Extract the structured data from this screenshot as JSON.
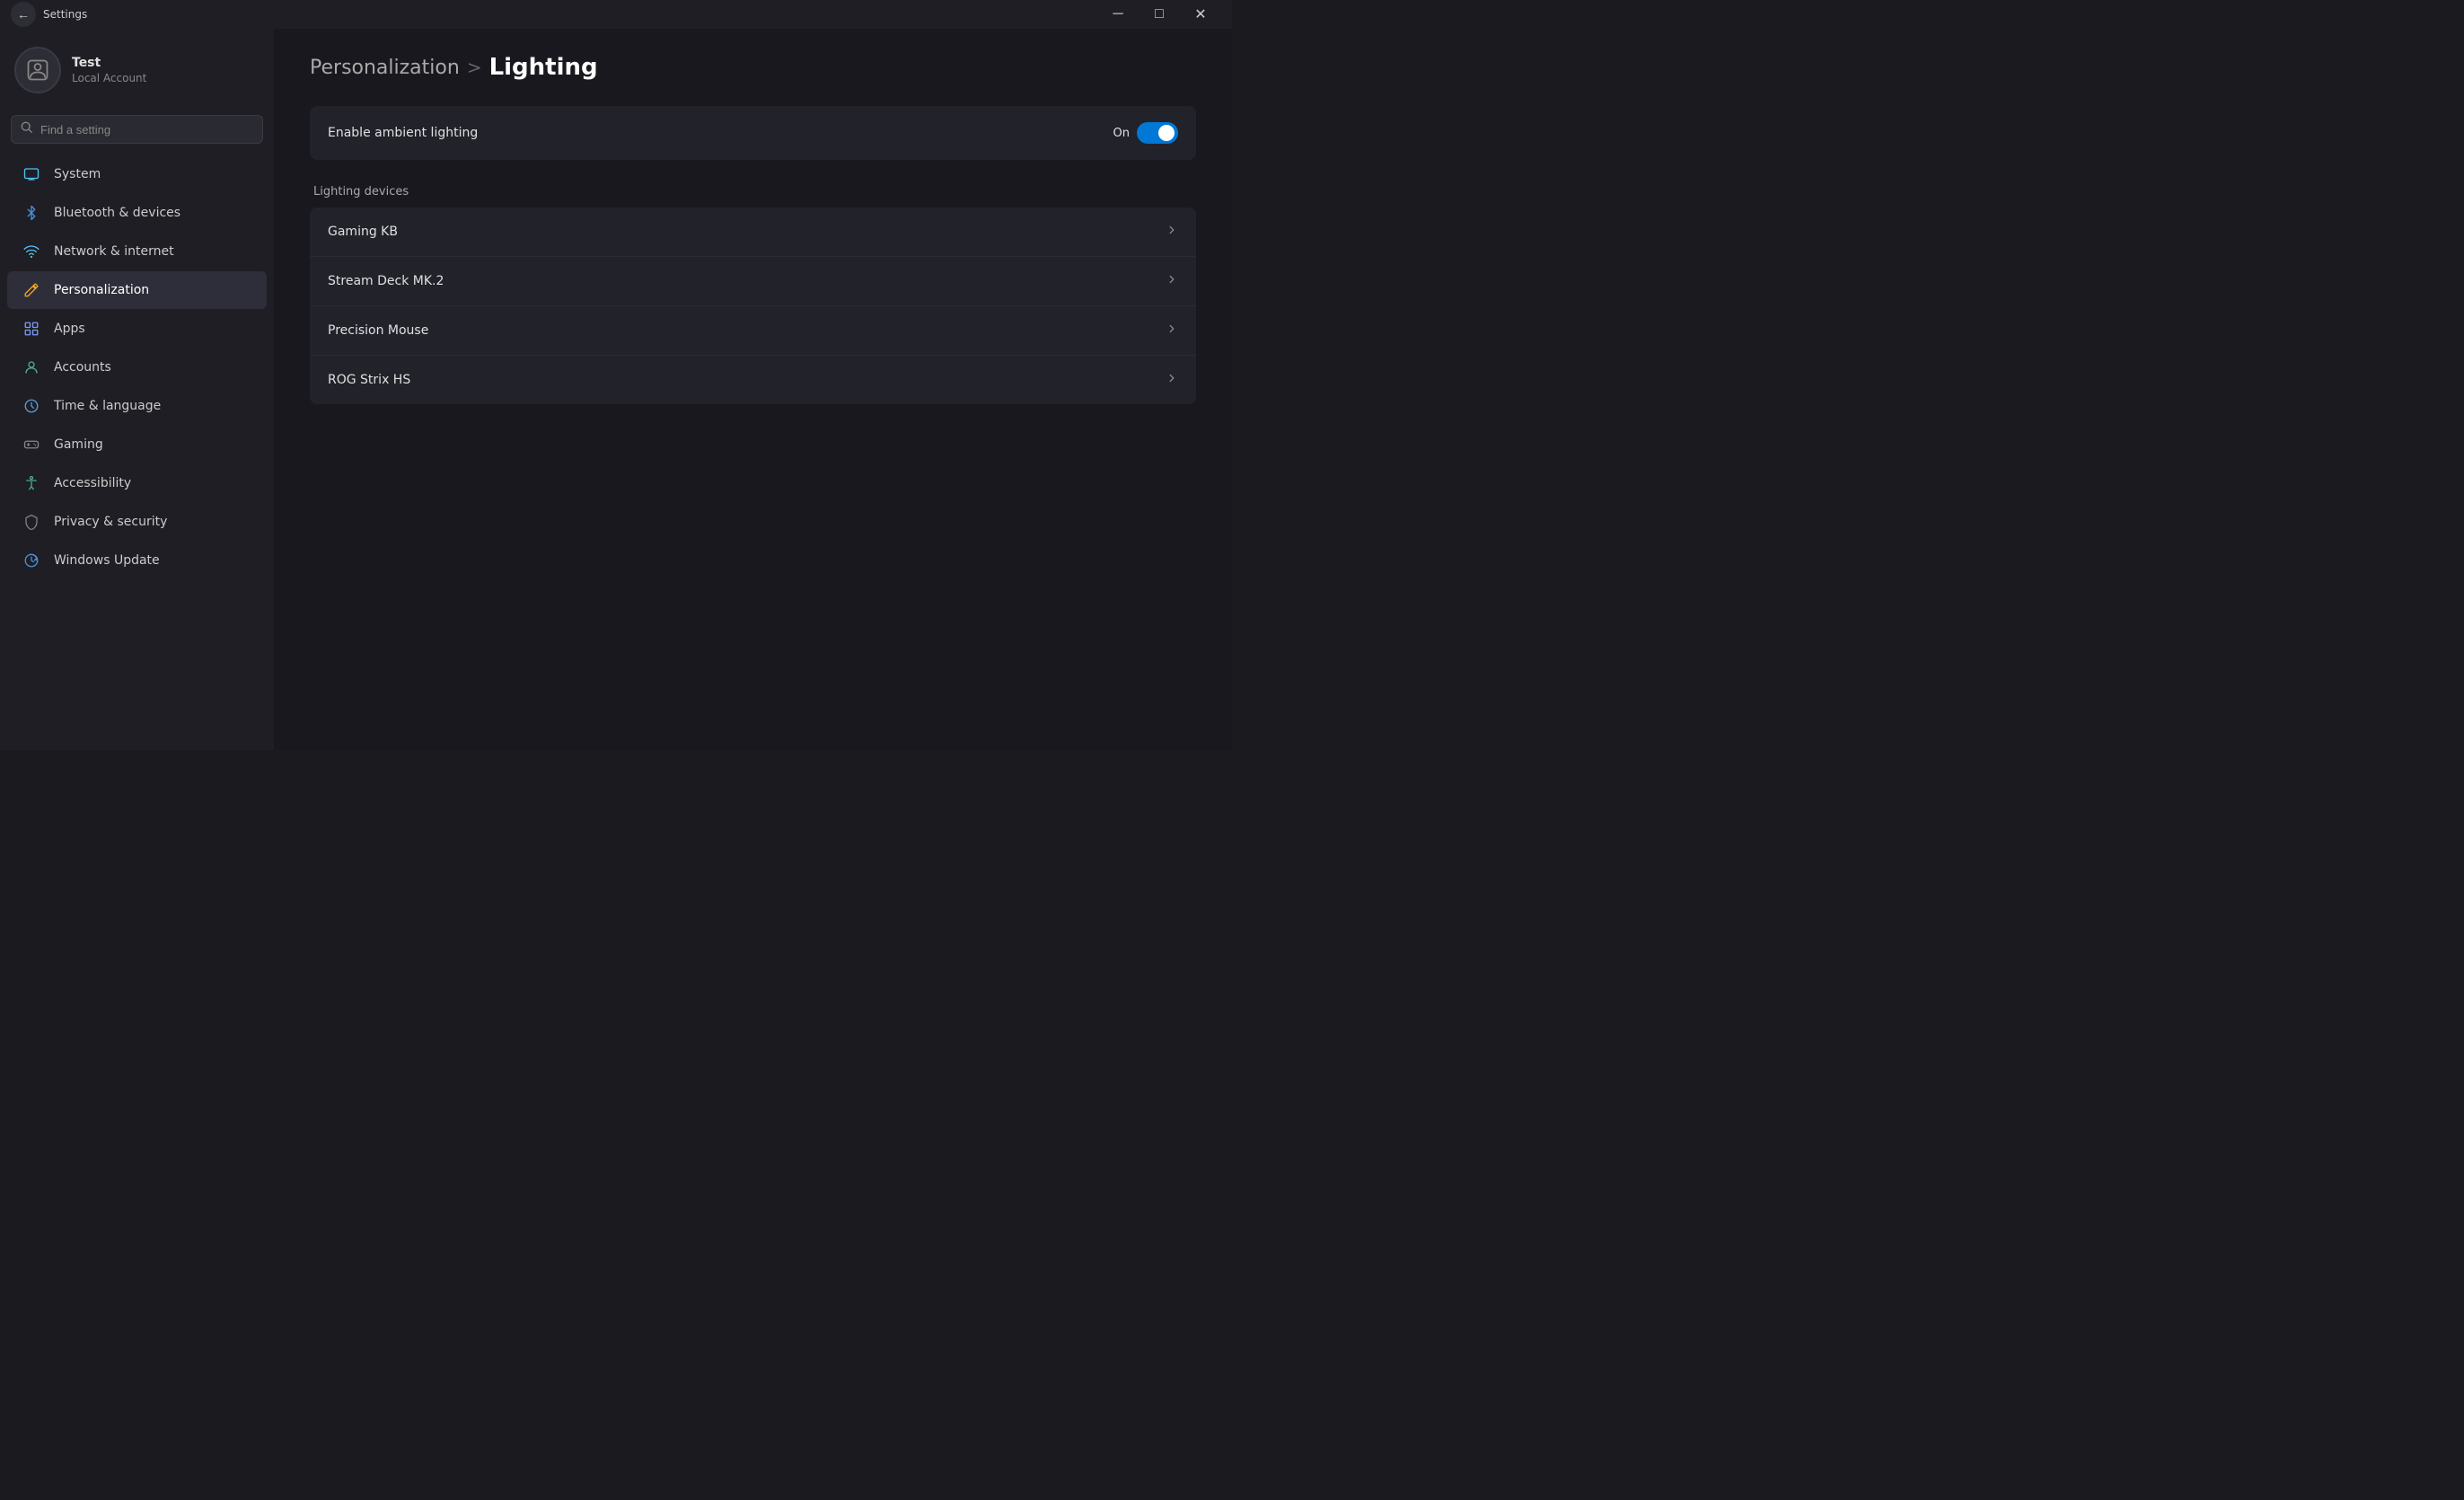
{
  "titlebar": {
    "title": "Settings",
    "back_label": "←",
    "minimize": "─",
    "maximize": "□",
    "close": "✕"
  },
  "user": {
    "name": "Test",
    "type": "Local Account",
    "avatar_icon": "👤"
  },
  "search": {
    "placeholder": "Find a setting"
  },
  "nav": {
    "items": [
      {
        "id": "system",
        "label": "System",
        "icon": "💻",
        "icon_class": "system"
      },
      {
        "id": "bluetooth",
        "label": "Bluetooth & devices",
        "icon": "🔵",
        "icon_class": "bluetooth"
      },
      {
        "id": "network",
        "label": "Network & internet",
        "icon": "🌐",
        "icon_class": "network"
      },
      {
        "id": "personalization",
        "label": "Personalization",
        "icon": "✏️",
        "icon_class": "personalization",
        "active": true
      },
      {
        "id": "apps",
        "label": "Apps",
        "icon": "📦",
        "icon_class": "apps"
      },
      {
        "id": "accounts",
        "label": "Accounts",
        "icon": "👤",
        "icon_class": "accounts"
      },
      {
        "id": "time",
        "label": "Time & language",
        "icon": "🕐",
        "icon_class": "time"
      },
      {
        "id": "gaming",
        "label": "Gaming",
        "icon": "🎮",
        "icon_class": "gaming"
      },
      {
        "id": "accessibility",
        "label": "Accessibility",
        "icon": "♿",
        "icon_class": "accessibility"
      },
      {
        "id": "privacy",
        "label": "Privacy & security",
        "icon": "🛡",
        "icon_class": "privacy"
      },
      {
        "id": "update",
        "label": "Windows Update",
        "icon": "🔄",
        "icon_class": "update"
      }
    ]
  },
  "breadcrumb": {
    "parent": "Personalization",
    "separator": ">",
    "current": "Lighting"
  },
  "ambient_lighting": {
    "label": "Enable ambient lighting",
    "state_label": "On",
    "enabled": true
  },
  "lighting_devices": {
    "section_label": "Lighting devices",
    "devices": [
      {
        "name": "Gaming KB"
      },
      {
        "name": "Stream Deck MK.2"
      },
      {
        "name": "Precision Mouse"
      },
      {
        "name": "ROG Strix HS"
      }
    ]
  }
}
